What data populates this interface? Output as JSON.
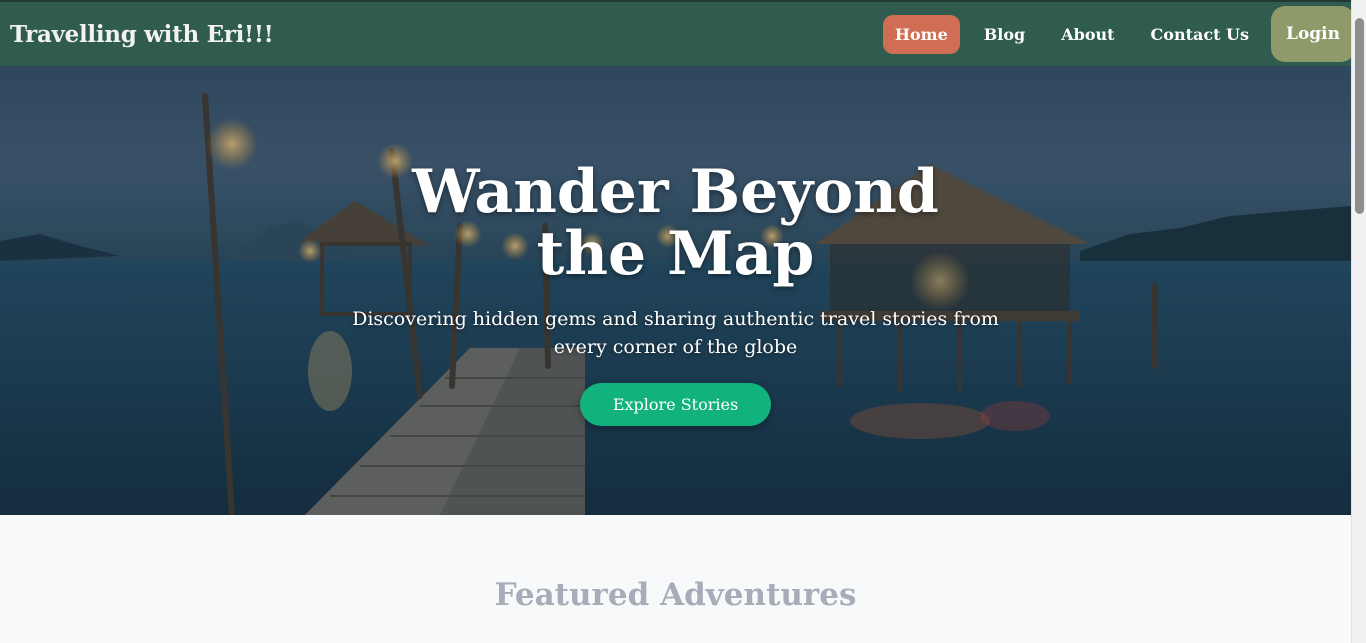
{
  "header": {
    "brand": "Travelling with Eri!!!",
    "nav": [
      {
        "label": "Home",
        "active": true
      },
      {
        "label": "Blog",
        "active": false
      },
      {
        "label": "About",
        "active": false
      },
      {
        "label": "Contact Us",
        "active": false
      }
    ],
    "login_label": "Login"
  },
  "hero": {
    "title": "Wander Beyond the Map",
    "subtitle": "Discovering hidden gems and sharing authentic travel stories from every corner of the globe",
    "cta_label": "Explore Stories"
  },
  "featured": {
    "heading": "Featured Adventures"
  },
  "colors": {
    "header_bg": "#2f5c4e",
    "active_nav": "#cf6e55",
    "login_bg": "#8e9a69",
    "cta_bg": "#12b27f",
    "featured_heading": "#a6acb8"
  }
}
